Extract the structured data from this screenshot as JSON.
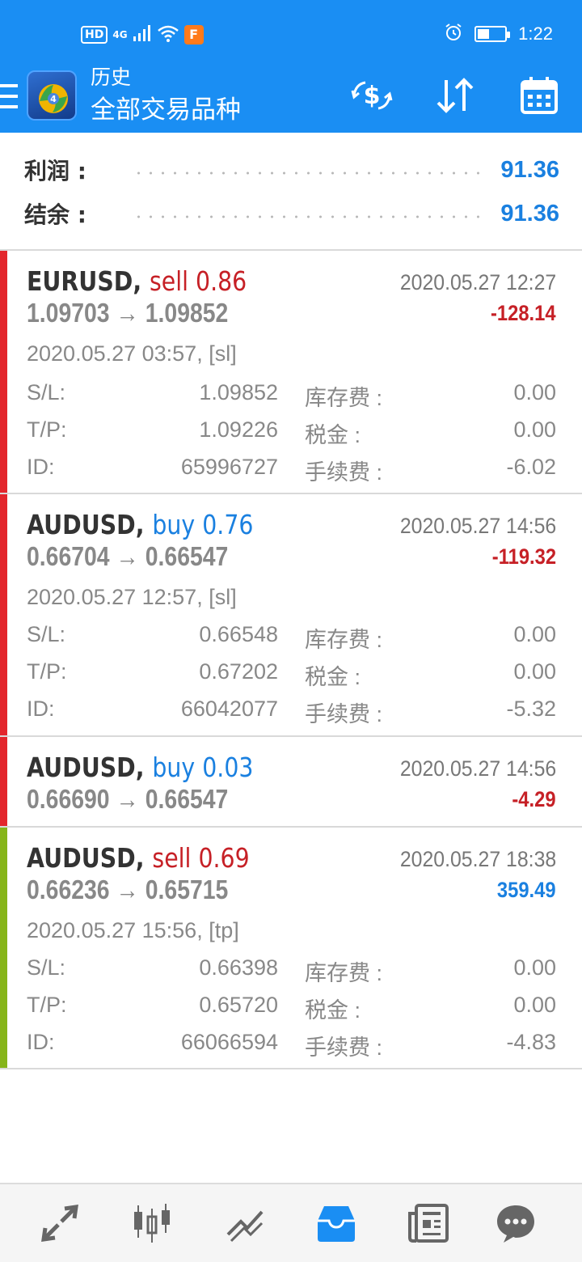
{
  "status_bar": {
    "hd_badge": "HD",
    "network": "4G",
    "app_badge": "F",
    "time": "1:22",
    "battery_level": 0.45
  },
  "header": {
    "title": "历史",
    "subtitle": "全部交易品种",
    "icons": [
      "menu-icon",
      "mt4-logo",
      "currency-exchange-icon",
      "sort-icon",
      "calendar-icon"
    ]
  },
  "summary": {
    "profit_label": "利润 :",
    "profit_value": "91.36",
    "balance_label": "结余 :",
    "balance_value": "91.36"
  },
  "deals": [
    {
      "symbol": "EURUSD,",
      "action": "sell 0.86",
      "close_time": "2020.05.27 12:27",
      "prices": "1.09703 → 1.09852",
      "profit": "-128.14",
      "open_info": "2020.05.27 03:57, [sl]",
      "sl_label": "S/L:",
      "sl": "1.09852",
      "tp_label": "T/P:",
      "tp": "1.09226",
      "id_label": "ID:",
      "id": "65996727",
      "swap_label": "库存费 :",
      "swap": "0.00",
      "tax_label": "税金 :",
      "tax": "0.00",
      "fee_label": "手续费 :",
      "fee": "-6.02"
    },
    {
      "symbol": "AUDUSD,",
      "action": "buy 0.76",
      "close_time": "2020.05.27 14:56",
      "prices": "0.66704 → 0.66547",
      "profit": "-119.32",
      "open_info": "2020.05.27 12:57, [sl]",
      "sl_label": "S/L:",
      "sl": "0.66548",
      "tp_label": "T/P:",
      "tp": "0.67202",
      "id_label": "ID:",
      "id": "66042077",
      "swap_label": "库存费 :",
      "swap": "0.00",
      "tax_label": "税金 :",
      "tax": "0.00",
      "fee_label": "手续费 :",
      "fee": "-5.32"
    },
    {
      "symbol": "AUDUSD,",
      "action": "buy 0.03",
      "close_time": "2020.05.27 14:56",
      "prices": "0.66690 → 0.66547",
      "profit": "-4.29"
    },
    {
      "symbol": "AUDUSD,",
      "action": "sell 0.69",
      "close_time": "2020.05.27 18:38",
      "prices": "0.66236 → 0.65715",
      "profit": "359.49",
      "open_info": "2020.05.27 15:56, [tp]",
      "sl_label": "S/L:",
      "sl": "0.66398",
      "tp_label": "T/P:",
      "tp": "0.65720",
      "id_label": "ID:",
      "id": "66066594",
      "swap_label": "库存费 :",
      "swap": "0.00",
      "tax_label": "税金 :",
      "tax": "0.00",
      "fee_label": "手续费 :",
      "fee": "-4.83"
    }
  ],
  "bottom_nav": [
    "trade-icon",
    "quotes-icon",
    "chart-icon",
    "history-icon",
    "news-icon",
    "chat-icon"
  ],
  "colors": {
    "accent": "#1a8ef3",
    "loss": "#c62026",
    "profit": "#1a80e0",
    "loss_bar": "#e3262c",
    "profit_bar": "#86b51a"
  }
}
